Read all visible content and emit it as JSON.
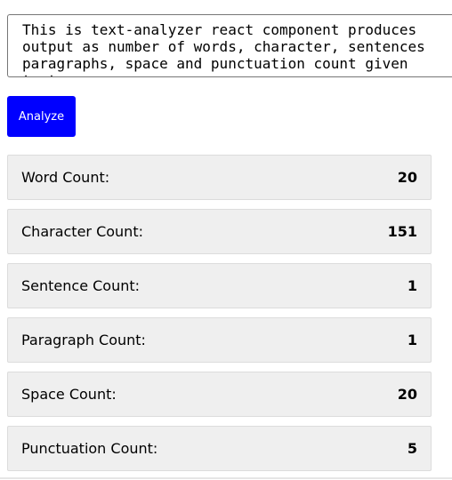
{
  "input": {
    "value": "This is text-analyzer react component produces output as number of words, character, sentences paragraphs, space and punctuation count given text."
  },
  "analyze_button": {
    "label": "Analyze"
  },
  "stats": [
    {
      "label": "Word Count:",
      "value": "20"
    },
    {
      "label": "Character Count:",
      "value": "151"
    },
    {
      "label": "Sentence Count:",
      "value": "1"
    },
    {
      "label": "Paragraph Count:",
      "value": "1"
    },
    {
      "label": "Space Count:",
      "value": "20"
    },
    {
      "label": "Punctuation Count:",
      "value": "5"
    }
  ],
  "colors": {
    "button_background": "#0000ff",
    "button_text": "#ffffff",
    "row_background": "#efefef"
  }
}
